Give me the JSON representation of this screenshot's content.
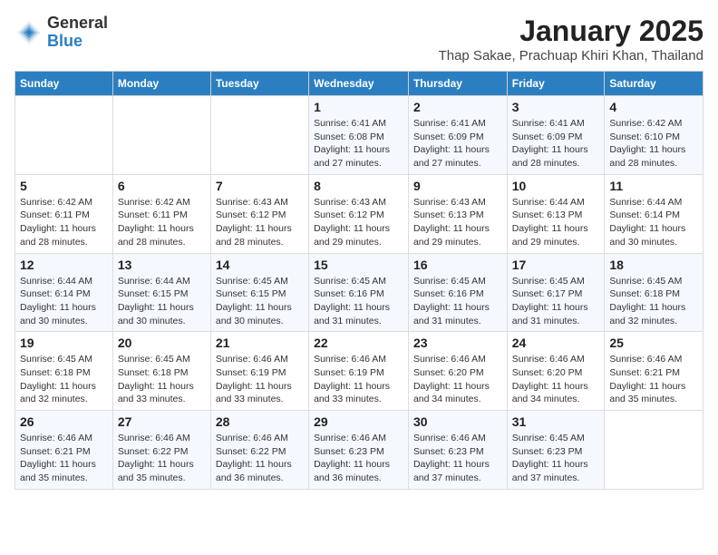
{
  "header": {
    "title": "January 2025",
    "location": "Thap Sakae, Prachuap Khiri Khan, Thailand",
    "logo_general": "General",
    "logo_blue": "Blue"
  },
  "columns": [
    "Sunday",
    "Monday",
    "Tuesday",
    "Wednesday",
    "Thursday",
    "Friday",
    "Saturday"
  ],
  "weeks": [
    [
      {
        "day": "",
        "info": ""
      },
      {
        "day": "",
        "info": ""
      },
      {
        "day": "",
        "info": ""
      },
      {
        "day": "1",
        "info": "Sunrise: 6:41 AM\nSunset: 6:08 PM\nDaylight: 11 hours and 27 minutes."
      },
      {
        "day": "2",
        "info": "Sunrise: 6:41 AM\nSunset: 6:09 PM\nDaylight: 11 hours and 27 minutes."
      },
      {
        "day": "3",
        "info": "Sunrise: 6:41 AM\nSunset: 6:09 PM\nDaylight: 11 hours and 28 minutes."
      },
      {
        "day": "4",
        "info": "Sunrise: 6:42 AM\nSunset: 6:10 PM\nDaylight: 11 hours and 28 minutes."
      }
    ],
    [
      {
        "day": "5",
        "info": "Sunrise: 6:42 AM\nSunset: 6:11 PM\nDaylight: 11 hours and 28 minutes."
      },
      {
        "day": "6",
        "info": "Sunrise: 6:42 AM\nSunset: 6:11 PM\nDaylight: 11 hours and 28 minutes."
      },
      {
        "day": "7",
        "info": "Sunrise: 6:43 AM\nSunset: 6:12 PM\nDaylight: 11 hours and 28 minutes."
      },
      {
        "day": "8",
        "info": "Sunrise: 6:43 AM\nSunset: 6:12 PM\nDaylight: 11 hours and 29 minutes."
      },
      {
        "day": "9",
        "info": "Sunrise: 6:43 AM\nSunset: 6:13 PM\nDaylight: 11 hours and 29 minutes."
      },
      {
        "day": "10",
        "info": "Sunrise: 6:44 AM\nSunset: 6:13 PM\nDaylight: 11 hours and 29 minutes."
      },
      {
        "day": "11",
        "info": "Sunrise: 6:44 AM\nSunset: 6:14 PM\nDaylight: 11 hours and 30 minutes."
      }
    ],
    [
      {
        "day": "12",
        "info": "Sunrise: 6:44 AM\nSunset: 6:14 PM\nDaylight: 11 hours and 30 minutes."
      },
      {
        "day": "13",
        "info": "Sunrise: 6:44 AM\nSunset: 6:15 PM\nDaylight: 11 hours and 30 minutes."
      },
      {
        "day": "14",
        "info": "Sunrise: 6:45 AM\nSunset: 6:15 PM\nDaylight: 11 hours and 30 minutes."
      },
      {
        "day": "15",
        "info": "Sunrise: 6:45 AM\nSunset: 6:16 PM\nDaylight: 11 hours and 31 minutes."
      },
      {
        "day": "16",
        "info": "Sunrise: 6:45 AM\nSunset: 6:16 PM\nDaylight: 11 hours and 31 minutes."
      },
      {
        "day": "17",
        "info": "Sunrise: 6:45 AM\nSunset: 6:17 PM\nDaylight: 11 hours and 31 minutes."
      },
      {
        "day": "18",
        "info": "Sunrise: 6:45 AM\nSunset: 6:18 PM\nDaylight: 11 hours and 32 minutes."
      }
    ],
    [
      {
        "day": "19",
        "info": "Sunrise: 6:45 AM\nSunset: 6:18 PM\nDaylight: 11 hours and 32 minutes."
      },
      {
        "day": "20",
        "info": "Sunrise: 6:45 AM\nSunset: 6:18 PM\nDaylight: 11 hours and 33 minutes."
      },
      {
        "day": "21",
        "info": "Sunrise: 6:46 AM\nSunset: 6:19 PM\nDaylight: 11 hours and 33 minutes."
      },
      {
        "day": "22",
        "info": "Sunrise: 6:46 AM\nSunset: 6:19 PM\nDaylight: 11 hours and 33 minutes."
      },
      {
        "day": "23",
        "info": "Sunrise: 6:46 AM\nSunset: 6:20 PM\nDaylight: 11 hours and 34 minutes."
      },
      {
        "day": "24",
        "info": "Sunrise: 6:46 AM\nSunset: 6:20 PM\nDaylight: 11 hours and 34 minutes."
      },
      {
        "day": "25",
        "info": "Sunrise: 6:46 AM\nSunset: 6:21 PM\nDaylight: 11 hours and 35 minutes."
      }
    ],
    [
      {
        "day": "26",
        "info": "Sunrise: 6:46 AM\nSunset: 6:21 PM\nDaylight: 11 hours and 35 minutes."
      },
      {
        "day": "27",
        "info": "Sunrise: 6:46 AM\nSunset: 6:22 PM\nDaylight: 11 hours and 35 minutes."
      },
      {
        "day": "28",
        "info": "Sunrise: 6:46 AM\nSunset: 6:22 PM\nDaylight: 11 hours and 36 minutes."
      },
      {
        "day": "29",
        "info": "Sunrise: 6:46 AM\nSunset: 6:23 PM\nDaylight: 11 hours and 36 minutes."
      },
      {
        "day": "30",
        "info": "Sunrise: 6:46 AM\nSunset: 6:23 PM\nDaylight: 11 hours and 37 minutes."
      },
      {
        "day": "31",
        "info": "Sunrise: 6:45 AM\nSunset: 6:23 PM\nDaylight: 11 hours and 37 minutes."
      },
      {
        "day": "",
        "info": ""
      }
    ]
  ]
}
